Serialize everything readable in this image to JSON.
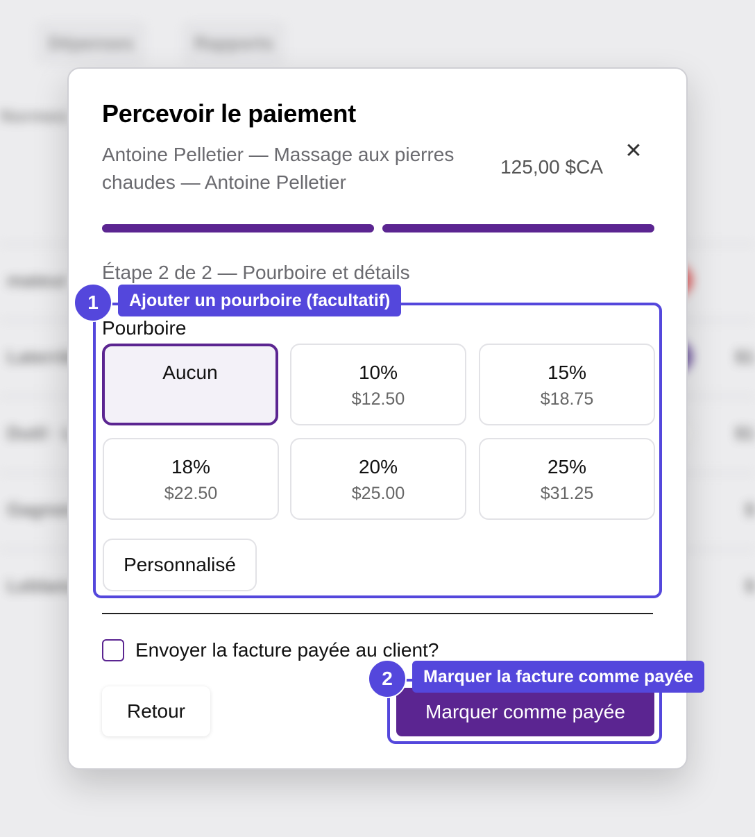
{
  "background": {
    "tabs": [
      "Dépenses",
      "Rapports"
    ],
    "left_label": "Normes",
    "rows": [
      {
        "label": "mateur",
        "right": "",
        "dot": "#e23a3a"
      },
      {
        "label": "Laterrière",
        "right": "$1",
        "dot": "#4b2a8a"
      },
      {
        "label": "Dutil · L",
        "right": "$1",
        "dot": "#f4f4f4"
      },
      {
        "label": "Gagnon",
        "right": "$",
        "dot": ""
      },
      {
        "label": "Leblanc",
        "right": "$",
        "dot": ""
      }
    ]
  },
  "modal": {
    "title": "Percevoir le paiement",
    "subtitle": "Antoine Pelletier — Massage aux pierres chaudes — Antoine Pelletier",
    "amount": "125,00 $CA",
    "close_glyph": "✕",
    "progress": {
      "current_step": 2,
      "total_steps": 2
    },
    "step_label": "Étape 2 de 2 — Pourboire et détails",
    "tip": {
      "title": "Pourboire",
      "options": [
        {
          "label": "Aucun",
          "amount": ""
        },
        {
          "label": "10%",
          "amount": "$12.50"
        },
        {
          "label": "15%",
          "amount": "$18.75"
        },
        {
          "label": "18%",
          "amount": "$22.50"
        },
        {
          "label": "20%",
          "amount": "$25.00"
        },
        {
          "label": "25%",
          "amount": "$31.25"
        }
      ],
      "selected_index": 0,
      "custom_label": "Personnalisé"
    },
    "send_invoice": {
      "label": "Envoyer la facture payée au client?",
      "checked": false
    },
    "back_label": "Retour",
    "pay_label": "Marquer comme payée"
  },
  "annotations": [
    {
      "number": "1",
      "label": "Ajouter un pourboire (facultatif)"
    },
    {
      "number": "2",
      "label": "Marquer la facture comme payée"
    }
  ],
  "colors": {
    "accent": "#5b2591",
    "annotation": "#5447dc"
  }
}
